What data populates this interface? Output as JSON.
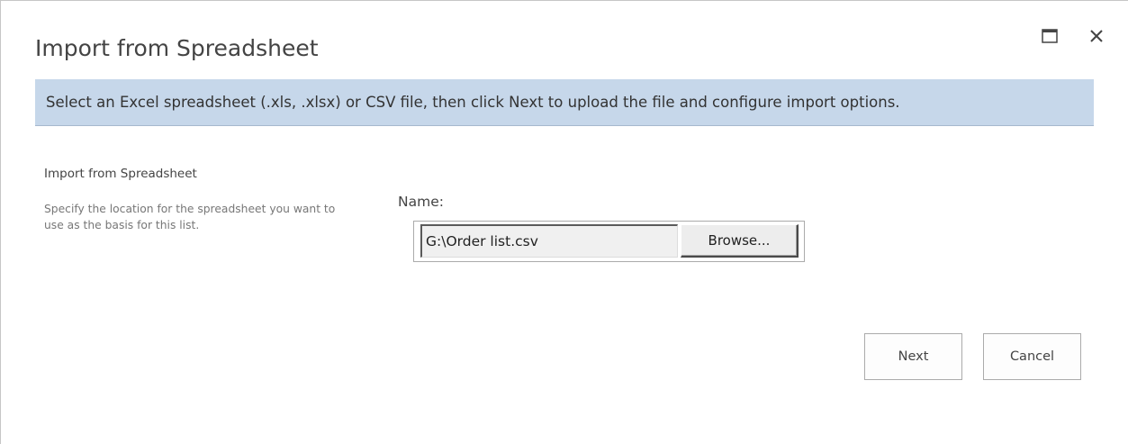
{
  "dialog": {
    "title": "Import from Spreadsheet",
    "window_controls": {
      "maximize_icon": "maximize-icon",
      "close_icon": "close-icon"
    }
  },
  "banner": {
    "text": "Select an Excel spreadsheet (.xls, .xlsx) or CSV file, then click Next to upload the file and configure import options.",
    "background_color": "#c6d7ea"
  },
  "section": {
    "title": "Import from Spreadsheet",
    "description": "Specify the location for the spreadsheet you want to use as the basis for this list."
  },
  "file_field": {
    "label": "Name:",
    "value": "G:\\Order list.csv",
    "browse_label": "Browse..."
  },
  "actions": {
    "next_label": "Next",
    "cancel_label": "Cancel"
  }
}
